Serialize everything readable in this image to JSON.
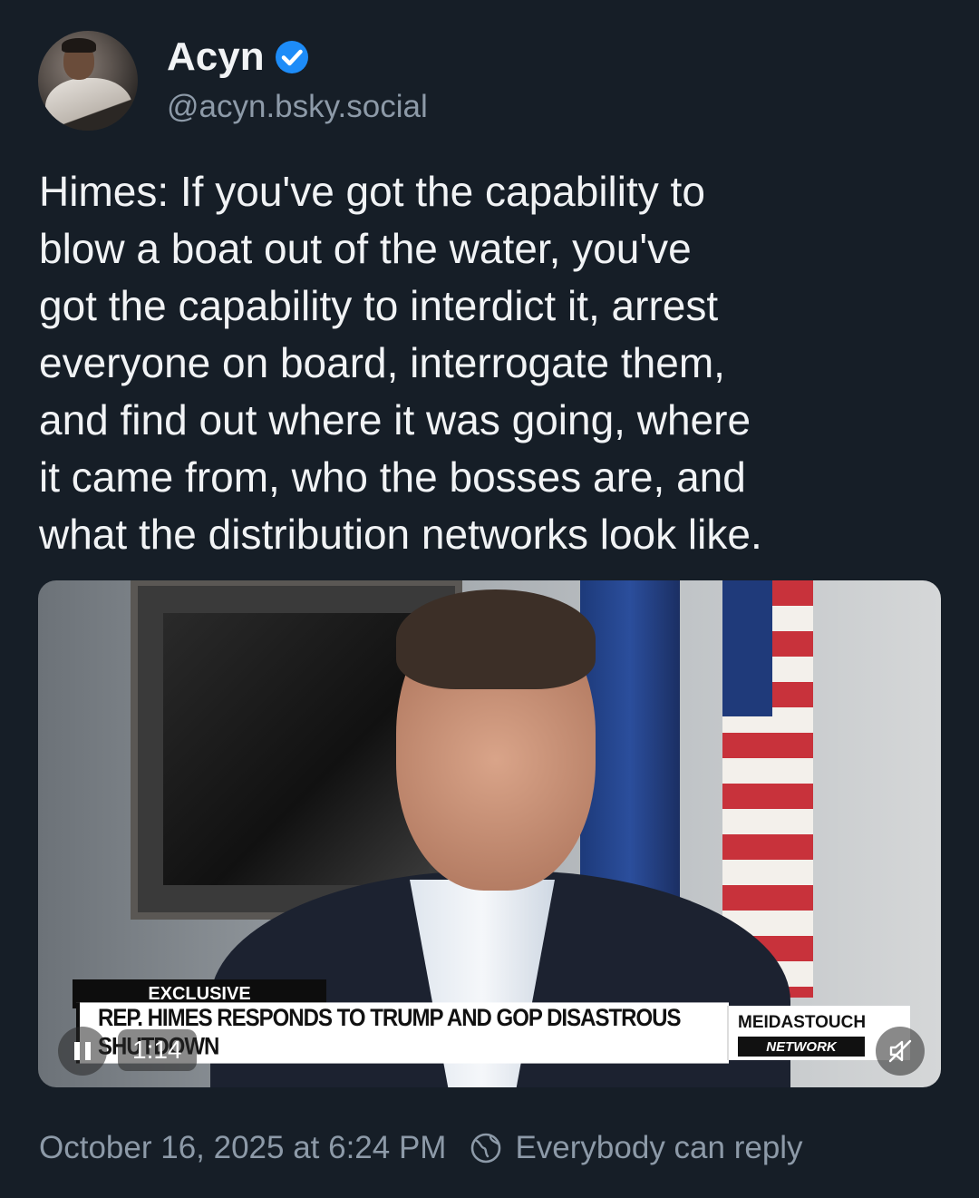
{
  "author": {
    "display_name": "Acyn",
    "handle": "@acyn.bsky.social",
    "verified_icon": "verified-check-icon"
  },
  "post": {
    "text": "Himes: If you've got the capability to\nblow a boat out of the water, you've\ngot the capability to interdict it, arrest\neveryone on board, interrogate them,\nand find out where it was going, where\nit came from, who the bosses are, and\nwhat the distribution networks look like."
  },
  "video": {
    "tag": "EXCLUSIVE",
    "headline": "REP. HIMES RESPONDS TO TRUMP AND GOP DISASTROUS SHUTDOWN",
    "brand_top": "MEIDASTOUCH",
    "brand_bottom": "NETWORK",
    "time": "1:14",
    "pause_icon": "pause-icon",
    "mute_icon": "muted-speaker-icon"
  },
  "footer": {
    "timestamp": "October 16, 2025 at 6:24 PM",
    "reply_setting": "Everybody can reply",
    "reply_icon": "globe-icon"
  },
  "colors": {
    "background": "#161e27",
    "text_primary": "#f1f3f5",
    "text_secondary": "#8d9aa8",
    "verified_blue": "#1d8cf8"
  }
}
